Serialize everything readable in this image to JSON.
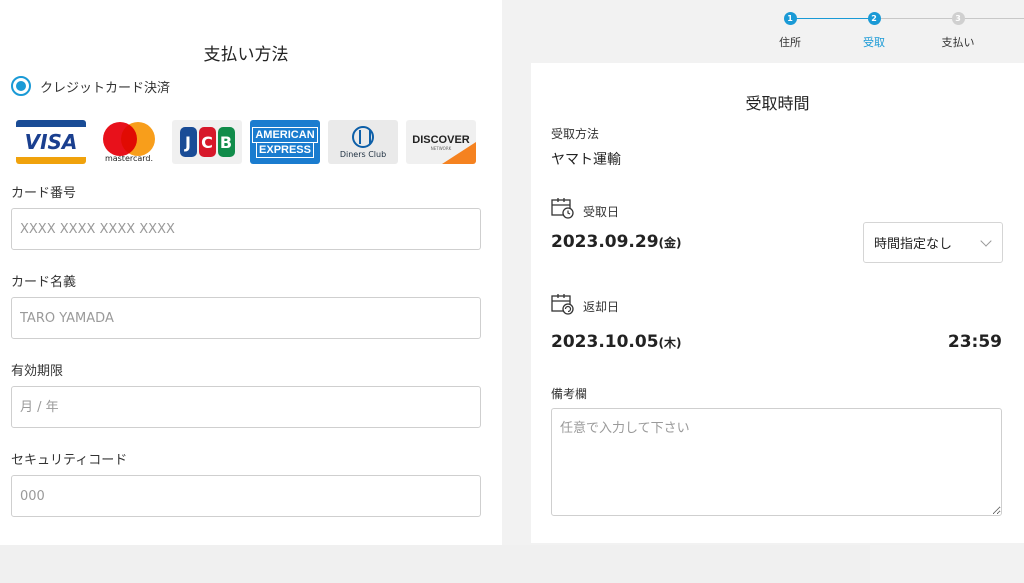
{
  "payment": {
    "title": "支払い方法",
    "method_label": "クレジットカード決済",
    "brands": [
      {
        "name": "VISA",
        "text": "VISA"
      },
      {
        "name": "mastercard",
        "text": "mastercard."
      },
      {
        "name": "JCB",
        "text": "JCB"
      },
      {
        "name": "American Express",
        "line1": "AMERICAN",
        "line2": "EXPRESS"
      },
      {
        "name": "Diners Club",
        "text": "Diners Club"
      },
      {
        "name": "Discover",
        "text": "DISCOVER",
        "sub": "NETWORK"
      }
    ],
    "card_number": {
      "label": "カード番号",
      "placeholder": "XXXX XXXX XXXX XXXX"
    },
    "card_name": {
      "label": "カード名義",
      "placeholder": "TARO YAMADA"
    },
    "expiry": {
      "label": "有効期限",
      "placeholder": "月 / 年"
    },
    "security_code": {
      "label": "セキュリティコード",
      "placeholder": "000"
    }
  },
  "stepper": {
    "steps": [
      {
        "number": "1",
        "label": "住所",
        "state": "done"
      },
      {
        "number": "2",
        "label": "受取",
        "state": "active"
      },
      {
        "number": "3",
        "label": "支払い",
        "state": "pending"
      }
    ],
    "colors": {
      "active": "#1a9ad6",
      "pending": "#c8c8c8"
    }
  },
  "pickup": {
    "title": "受取時間",
    "method_label": "受取方法",
    "method_value": "ヤマト運輸",
    "pickup_date_label": "受取日",
    "pickup_date": "2023.09.29",
    "pickup_dow": "(金)",
    "time_select": "時間指定なし",
    "return_date_label": "返却日",
    "return_date": "2023.10.05",
    "return_dow": "(木)",
    "return_time": "23:59",
    "notes_label": "備考欄",
    "notes_placeholder": "任意で入力して下さい"
  },
  "colors": {
    "accent": "#1a9ad6",
    "page_bg": "#f2f2f2"
  }
}
